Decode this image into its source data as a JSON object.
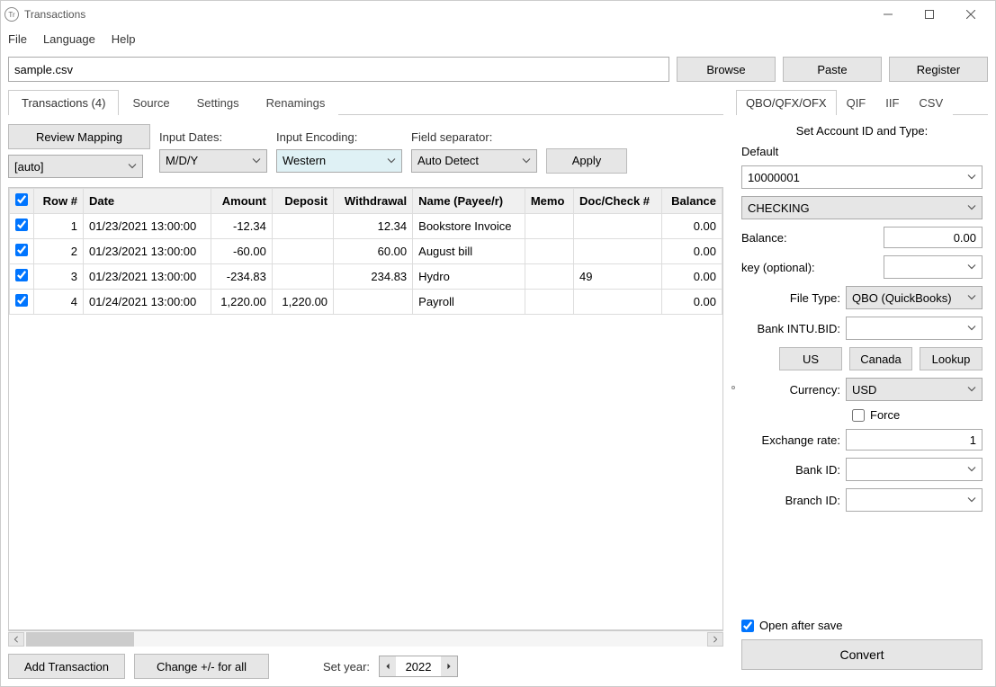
{
  "window": {
    "title": "Transactions"
  },
  "menu": {
    "file": "File",
    "language": "Language",
    "help": "Help"
  },
  "toprow": {
    "filename": "sample.csv",
    "browse": "Browse",
    "paste": "Paste",
    "register": "Register"
  },
  "left": {
    "tabs": {
      "transactions": "Transactions (4)",
      "source": "Source",
      "settings": "Settings",
      "renamings": "Renamings"
    },
    "review_mapping": "Review Mapping",
    "input_dates_label": "Input Dates:",
    "input_encoding_label": "Input Encoding:",
    "field_separator_label": "Field separator:",
    "auto_select": "[auto]",
    "date_format": "M/D/Y",
    "encoding": "Western",
    "separator": "Auto Detect",
    "apply": "Apply",
    "headers": {
      "row": "Row #",
      "date": "Date",
      "amount": "Amount",
      "deposit": "Deposit",
      "withdrawal": "Withdrawal",
      "name": "Name (Payee/r)",
      "memo": "Memo",
      "doc": "Doc/Check #",
      "balance": "Balance"
    },
    "rows": [
      {
        "n": "1",
        "date": "01/23/2021 13:00:00",
        "amount": "-12.34",
        "deposit": "",
        "withdrawal": "12.34",
        "name": "Bookstore Invoice",
        "memo": "",
        "doc": "",
        "balance": "0.00"
      },
      {
        "n": "2",
        "date": "01/23/2021 13:00:00",
        "amount": "-60.00",
        "deposit": "",
        "withdrawal": "60.00",
        "name": "August bill",
        "memo": "",
        "doc": "",
        "balance": "0.00"
      },
      {
        "n": "3",
        "date": "01/23/2021 13:00:00",
        "amount": "-234.83",
        "deposit": "",
        "withdrawal": "234.83",
        "name": "Hydro",
        "memo": "",
        "doc": "49",
        "balance": "0.00"
      },
      {
        "n": "4",
        "date": "01/24/2021 13:00:00",
        "amount": "1,220.00",
        "deposit": "1,220.00",
        "withdrawal": "",
        "name": "Payroll",
        "memo": "",
        "doc": "",
        "balance": "0.00"
      }
    ],
    "add_transaction": "Add Transaction",
    "change_sign": "Change +/- for all",
    "set_year_label": "Set year:",
    "year": "2022"
  },
  "right": {
    "tabs": {
      "qbo": "QBO/QFX/OFX",
      "qif": "QIF",
      "iif": "IIF",
      "csv": "CSV"
    },
    "heading": "Set Account ID and Type:",
    "default_label": "Default",
    "account_id": "10000001",
    "account_type": "CHECKING",
    "balance_label": "Balance:",
    "balance": "0.00",
    "key_label": "key (optional):",
    "key": "",
    "filetype_label": "File Type:",
    "filetype": "QBO (QuickBooks)",
    "bankintu_label": "Bank INTU.BID:",
    "bankintu": "",
    "us": "US",
    "canada": "Canada",
    "lookup": "Lookup",
    "currency_label": "Currency:",
    "currency": "USD",
    "force": "Force",
    "exchange_label": "Exchange rate:",
    "exchange": "1",
    "bankid_label": "Bank ID:",
    "bankid": "",
    "branchid_label": "Branch ID:",
    "branchid": "",
    "open_after_save": "Open after save",
    "convert": "Convert"
  }
}
